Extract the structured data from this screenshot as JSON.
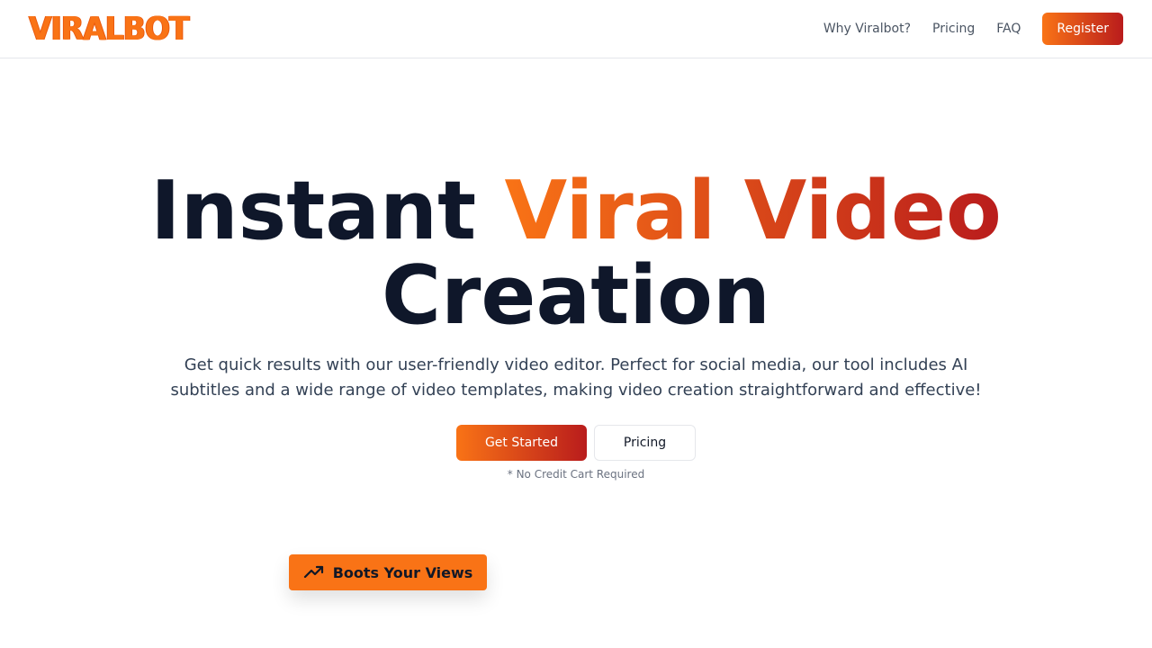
{
  "brand": {
    "logo_text": "VIRALBOT"
  },
  "nav": {
    "links": [
      "Why Viralbot?",
      "Pricing",
      "FAQ"
    ],
    "register_label": "Register"
  },
  "hero": {
    "headline_plain_1": "Instant ",
    "headline_gradient": "Viral Video",
    "headline_plain_2": "Creation",
    "subtitle": "Get quick results with our user-friendly video editor. Perfect for social media, our tool includes AI subtitles and a wide range of video templates, making video creation straightforward and effective!",
    "primary_cta": "Get Started",
    "secondary_cta": "Pricing",
    "note": "* No Credit Cart Required"
  },
  "badge": {
    "icon": "trending-up-icon",
    "label": "Boots Your Views"
  },
  "colors": {
    "accent_start": "#f97316",
    "accent_end": "#b91c1c",
    "heading": "#0f172a"
  }
}
